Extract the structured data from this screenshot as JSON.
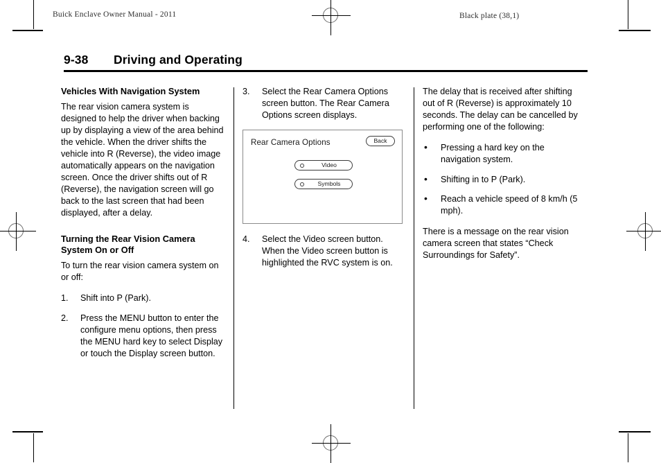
{
  "running_head": {
    "left": "Buick Enclave Owner Manual - 2011",
    "right": "Black plate (38,1)"
  },
  "page_title": {
    "number": "9-38",
    "text": "Driving and Operating"
  },
  "column_1": {
    "heading_1": "Vehicles With Navigation System",
    "paragraph_1": "The rear vision camera system is designed to help the driver when backing up by displaying a view of the area behind the vehicle. When the driver shifts the vehicle into R (Reverse), the video image automatically appears on the navigation screen. Once the driver shifts out of R (Reverse), the navigation screen will go back to the last screen that had been displayed, after a delay.",
    "heading_2": "Turning the Rear Vision Camera System On or Off",
    "paragraph_2": "To turn the rear vision camera system on or off:",
    "steps": [
      {
        "number": "1.",
        "text": "Shift into P (Park)."
      },
      {
        "number": "2.",
        "text": "Press the MENU button to enter the configure menu options, then press the MENU hard key to select Display or touch the Display screen button."
      }
    ]
  },
  "column_2": {
    "steps_top": [
      {
        "number": "3.",
        "text": "Select the Rear Camera Options screen button. The Rear Camera Options screen displays."
      }
    ],
    "figure": {
      "screen_title": "Rear Camera Options",
      "back_button": "Back",
      "options": [
        {
          "label": "Video",
          "selected": false
        },
        {
          "label": "Symbols",
          "selected": false
        }
      ]
    },
    "steps_bottom": [
      {
        "number": "4.",
        "text": "Select the Video screen button. When the Video screen button is highlighted the RVC system is on."
      }
    ]
  },
  "column_3": {
    "paragraph_1": "The delay that is received after shifting out of R (Reverse) is approximately 10 seconds. The delay can be cancelled by performing one of the following:",
    "bullets": [
      "Pressing a hard key on the navigation system.",
      "Shifting in to P (Park).",
      "Reach a vehicle speed of 8 km/h (5 mph)."
    ],
    "paragraph_2": "There is a message on the rear vision camera screen that states “Check Surroundings for Safety”."
  },
  "marks": {
    "bullet_glyph": "•"
  }
}
